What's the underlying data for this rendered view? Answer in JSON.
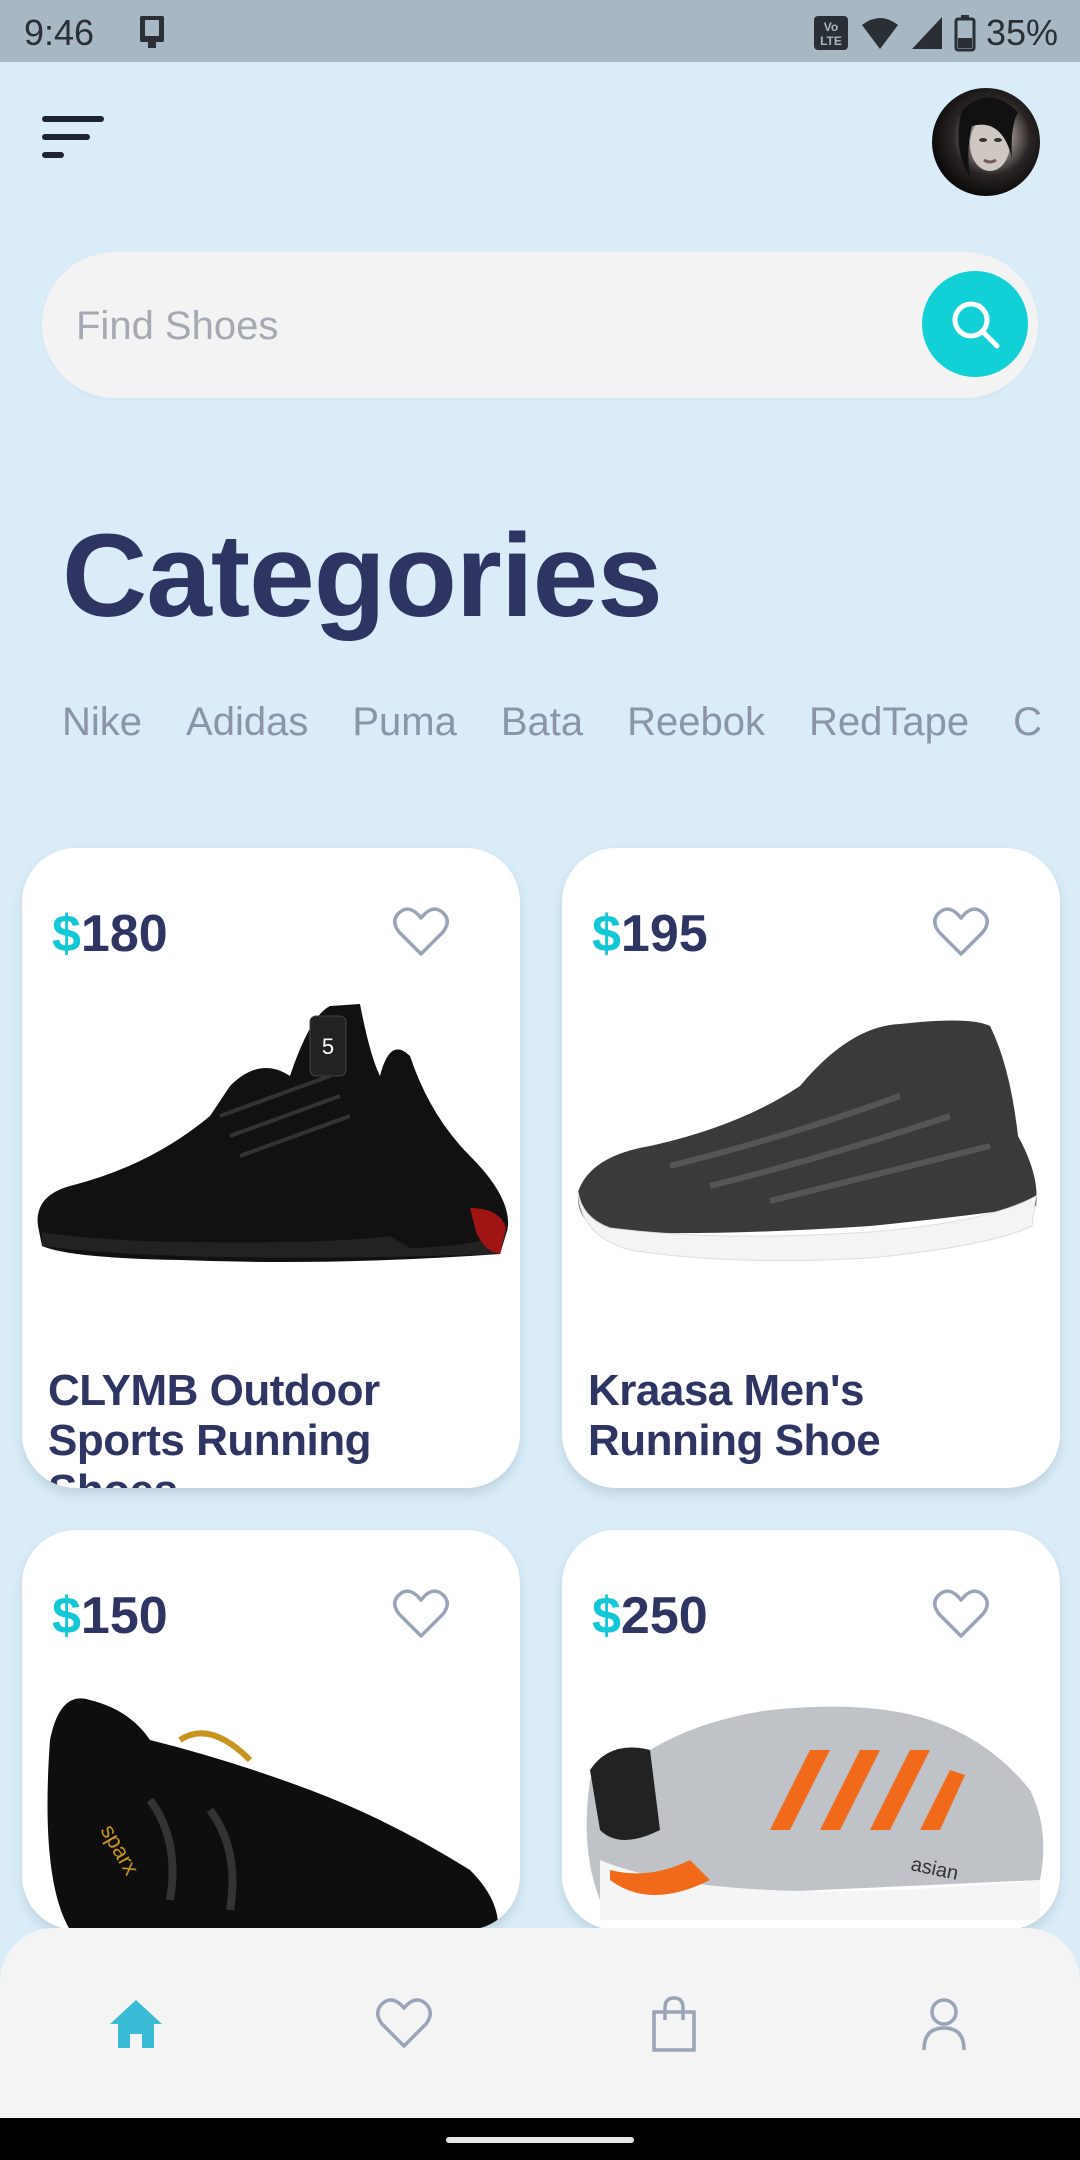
{
  "status_bar": {
    "time": "9:46",
    "battery": "35%"
  },
  "search": {
    "placeholder": "Find Shoes"
  },
  "categories": {
    "title": "Categories",
    "items": [
      "Nike",
      "Adidas",
      "Puma",
      "Bata",
      "Reebok",
      "RedTape",
      "C"
    ]
  },
  "products": [
    {
      "currency": "$",
      "price": "180",
      "name": "CLYMB Outdoor Sports Running Shoes"
    },
    {
      "currency": "$",
      "price": "195",
      "name": "Kraasa Men's Running Shoe"
    },
    {
      "currency": "$",
      "price": "150",
      "name": ""
    },
    {
      "currency": "$",
      "price": "250",
      "name": ""
    }
  ],
  "nav": {
    "items": [
      "home-icon",
      "heart-icon",
      "bag-icon",
      "profile-icon"
    ],
    "active": "home-icon"
  },
  "colors": {
    "background": "#d9ecf8",
    "accent": "#12d1d6",
    "title": "#2e3563",
    "active_nav": "#3bbcd6"
  }
}
